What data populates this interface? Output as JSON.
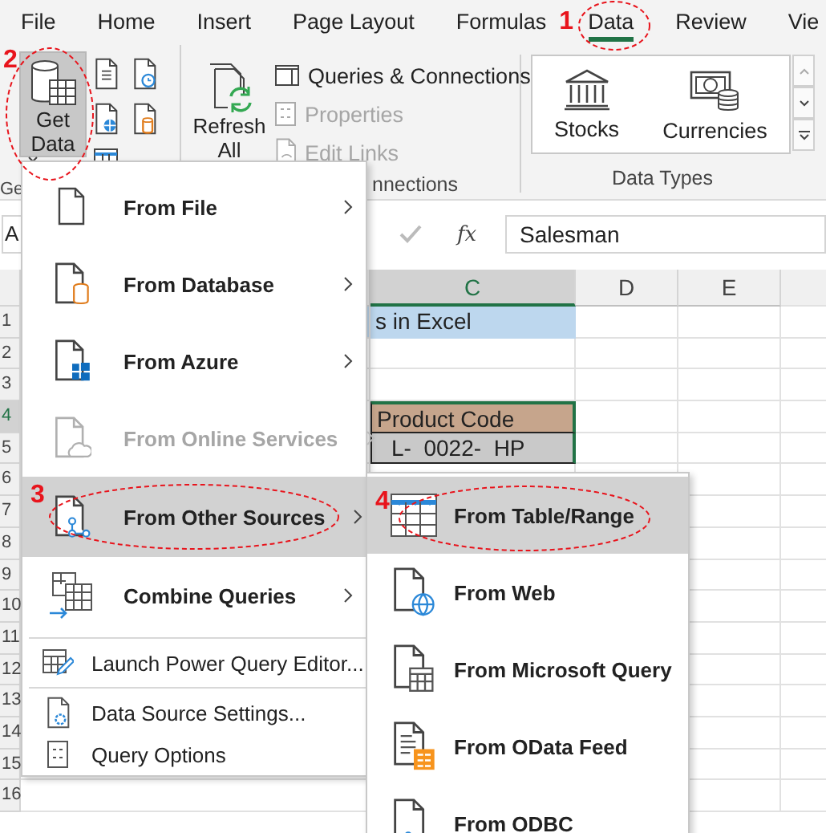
{
  "tabs": [
    {
      "label": "File",
      "selected": false
    },
    {
      "label": "Home",
      "selected": false
    },
    {
      "label": "Insert",
      "selected": false
    },
    {
      "label": "Page Layout",
      "selected": false
    },
    {
      "label": "Formulas",
      "selected": false
    },
    {
      "label": "Data",
      "selected": true,
      "annotation": "1"
    },
    {
      "label": "Review",
      "selected": false
    },
    {
      "label": "Vie",
      "selected": false
    }
  ],
  "ribbon": {
    "get_data": {
      "label": "Get Data",
      "selected": true,
      "annotation": "2"
    },
    "group_1_label": "Ge",
    "refresh": {
      "label": "Refresh All"
    },
    "queries": [
      {
        "label": "Queries & Connections",
        "disabled": false
      },
      {
        "label": "Properties",
        "disabled": true
      },
      {
        "label": "Edit Links",
        "disabled": true
      }
    ],
    "group_2_label": "nnections",
    "data_types": [
      {
        "label": "Stocks"
      },
      {
        "label": "Currencies"
      }
    ],
    "group_3_label": "Data Types"
  },
  "formula_bar": {
    "name_box": "A",
    "function_label": "fx",
    "value": "Salesman"
  },
  "sheet": {
    "columns": [
      {
        "label": "C",
        "selected": true
      },
      {
        "label": "D",
        "selected": false
      },
      {
        "label": "E",
        "selected": false
      }
    ],
    "rows": [
      {
        "number": "1",
        "selected": false,
        "cell_c": {
          "text": "s in Excel",
          "kind": "title"
        }
      },
      {
        "number": "2",
        "selected": false
      },
      {
        "number": "3",
        "selected": false
      },
      {
        "number": "4",
        "selected": true,
        "cell_c": {
          "text": "Product Code",
          "kind": "header"
        }
      },
      {
        "number": "5",
        "selected": false,
        "cell_c": {
          "text": "L-  0022-  HP",
          "kind": "data"
        }
      },
      {
        "number": "6",
        "selected": false
      },
      {
        "number": "7",
        "selected": false
      },
      {
        "number": "8",
        "selected": false
      },
      {
        "number": "9",
        "selected": false
      },
      {
        "number": "10",
        "selected": false
      },
      {
        "number": "11",
        "selected": false
      },
      {
        "number": "12",
        "selected": false
      },
      {
        "number": "13",
        "selected": false
      },
      {
        "number": "14",
        "selected": false
      },
      {
        "number": "15",
        "selected": false
      },
      {
        "number": "16",
        "selected": false
      }
    ]
  },
  "menu": {
    "items": [
      {
        "kind": "large",
        "label": "From File",
        "disabled": false,
        "selected": false,
        "submenu": true
      },
      {
        "kind": "large",
        "label": "From Database",
        "disabled": false,
        "selected": false,
        "submenu": true
      },
      {
        "kind": "large",
        "label": "From Azure",
        "disabled": false,
        "selected": false,
        "submenu": true
      },
      {
        "kind": "large",
        "label": "From Online Services",
        "disabled": true,
        "selected": false,
        "submenu": true
      },
      {
        "kind": "large",
        "label": "From Other Sources",
        "disabled": false,
        "selected": true,
        "submenu": true,
        "annotation": "3"
      },
      {
        "kind": "large",
        "label": "Combine Queries",
        "disabled": false,
        "selected": false,
        "submenu": true
      },
      {
        "kind": "separator"
      },
      {
        "kind": "small",
        "label": "Launch Power Query Editor...",
        "disabled": false,
        "selected": false
      },
      {
        "kind": "separator"
      },
      {
        "kind": "small",
        "label": "Data Source Settings...",
        "disabled": false,
        "selected": false
      },
      {
        "kind": "small",
        "label": "Query Options",
        "disabled": false,
        "selected": false
      }
    ]
  },
  "submenu": {
    "items": [
      {
        "label": "From Table/Range",
        "selected": true,
        "annotation": "4"
      },
      {
        "label": "From Web",
        "selected": false
      },
      {
        "label": "From Microsoft Query",
        "selected": false
      },
      {
        "label": "From OData Feed",
        "selected": false
      },
      {
        "label": "From ODBC",
        "selected": false
      }
    ]
  }
}
